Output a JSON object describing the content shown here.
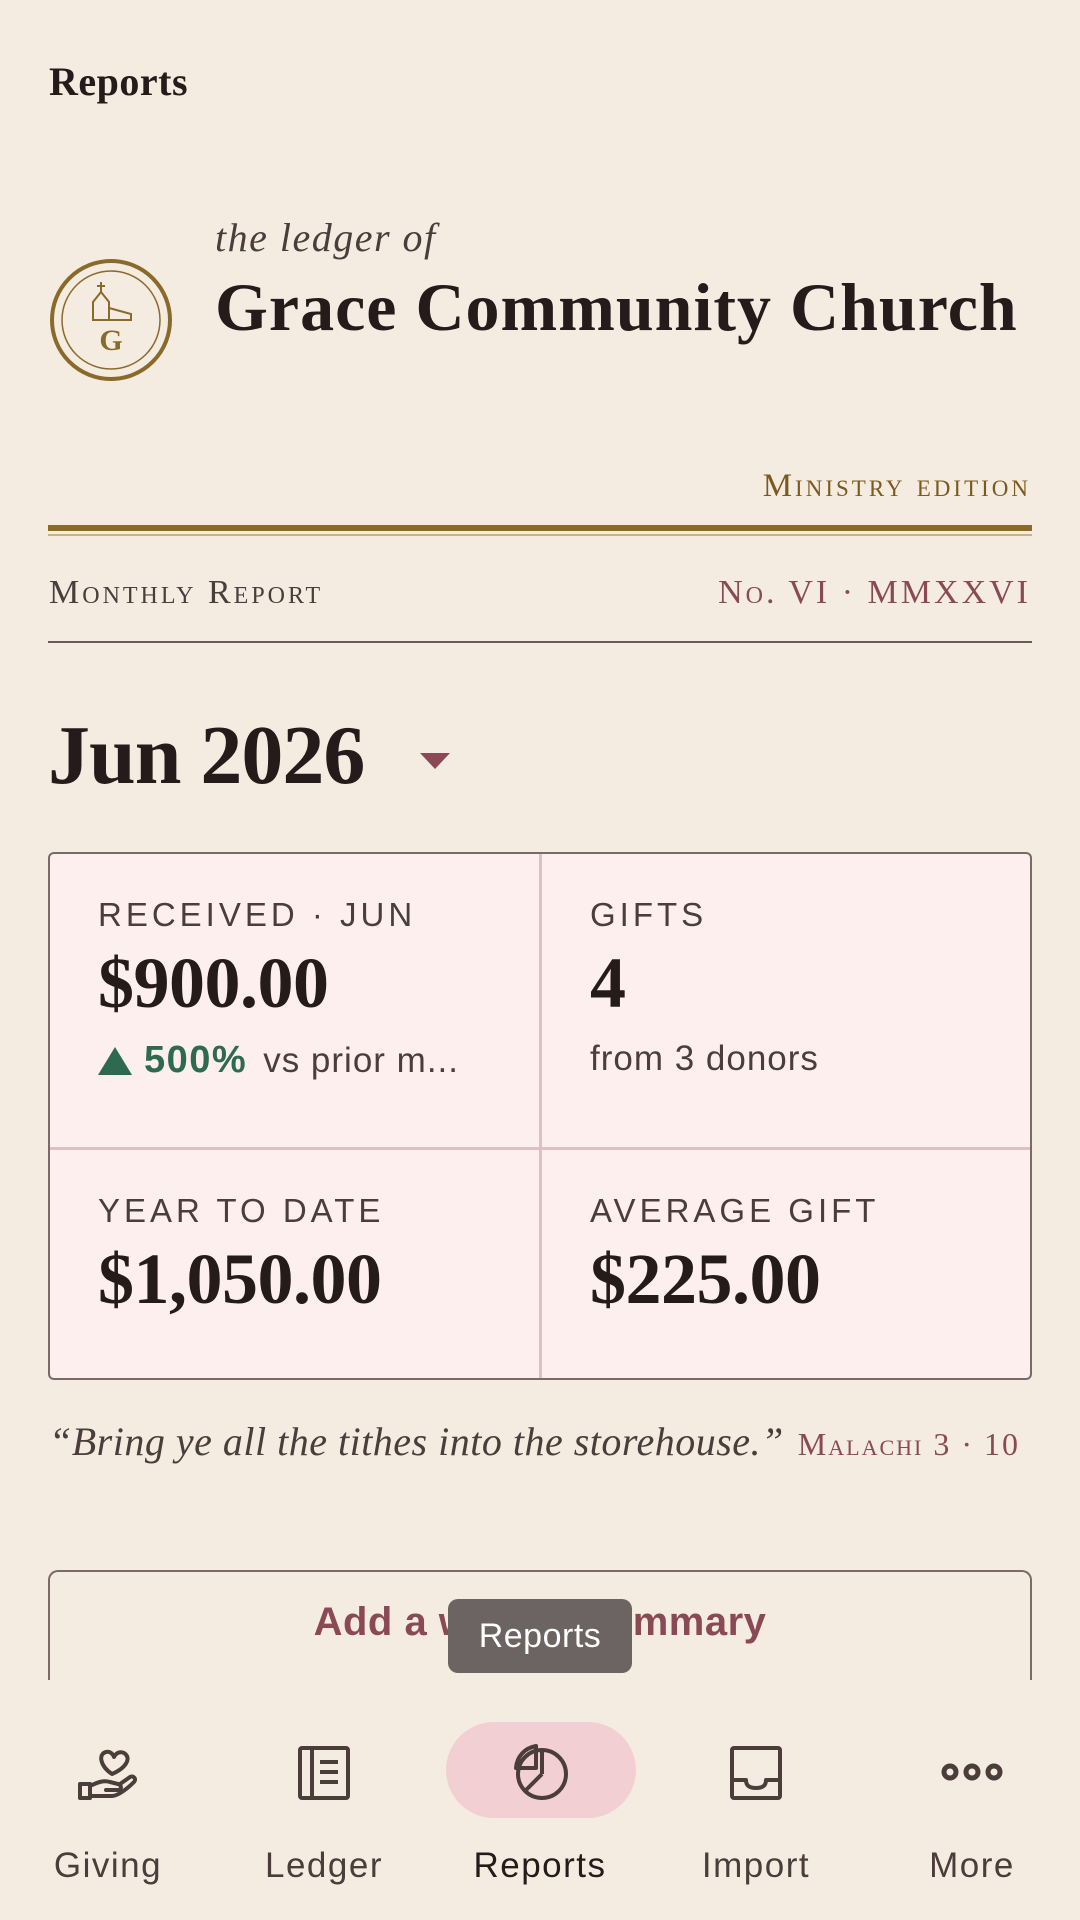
{
  "app_bar": {
    "title": "Reports"
  },
  "masthead": {
    "kicker": "the ledger of",
    "church_name": "Grace Community Church",
    "edition": "Ministry edition",
    "seal_letter": "G",
    "accent_gold": "#8a6a2a"
  },
  "report": {
    "label": "Monthly Report",
    "number": "No. VI · MMXXVI"
  },
  "period": {
    "selected_month": "Jun 2026"
  },
  "stats": {
    "received": {
      "label": "Received · Jun",
      "value": "$900.00",
      "change_pct": "500%",
      "change_text": "vs prior m..."
    },
    "gifts": {
      "label": "Gifts",
      "value": "4",
      "sub": "from 3 donors"
    },
    "ytd": {
      "label": "Year to date",
      "value": "$1,050.00"
    },
    "average": {
      "label": "Average gift",
      "value": "$225.00"
    }
  },
  "quote": {
    "text": "“Bring ye all the tithes into the storehouse.”",
    "citation": "Malachi 3 · 10"
  },
  "summary_button": {
    "label": "Add a written summary"
  },
  "tooltip": {
    "text": "Reports"
  },
  "nav": {
    "items": [
      {
        "label": "Giving",
        "icon": "giving-hand-heart-icon"
      },
      {
        "label": "Ledger",
        "icon": "ledger-book-icon"
      },
      {
        "label": "Reports",
        "icon": "pie-chart-icon",
        "active": true
      },
      {
        "label": "Import",
        "icon": "inbox-tray-icon"
      },
      {
        "label": "More",
        "icon": "more-dots-icon"
      }
    ]
  },
  "colors": {
    "positive": "#2e6a50",
    "accent_rose": "#8a4a55",
    "active_pill": "#f2cfd3"
  }
}
